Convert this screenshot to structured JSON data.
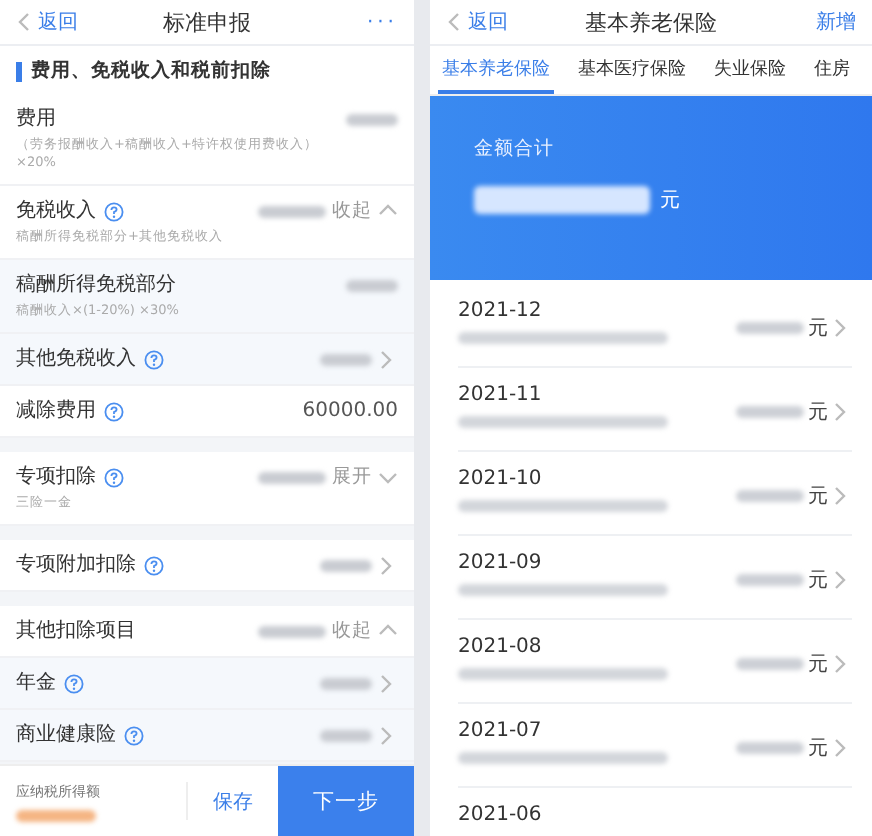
{
  "left": {
    "header": {
      "back": "返回",
      "title": "标准申报",
      "more": "···"
    },
    "section_title": "费用、免税收入和税前扣除",
    "groups": [
      {
        "rows": [
          {
            "label": "费用",
            "help": false,
            "sub": "（劳务报酬收入+稿酬收入+特许权使用费收入）×20%",
            "masked": true,
            "arrow": false
          },
          {
            "label": "免税收入",
            "help": true,
            "sub": "稿酬所得免税部分+其他免税收入",
            "masked": true,
            "toggle": "收起",
            "expanded": true,
            "children": [
              {
                "label": "稿酬所得免税部分",
                "help": false,
                "sub": "稿酬收入×(1-20%) ×30%",
                "masked": true,
                "arrow": false
              },
              {
                "label": "其他免税收入",
                "help": true,
                "masked": true,
                "arrow": true
              }
            ]
          },
          {
            "label": "减除费用",
            "help": true,
            "value": "60000.00",
            "masked": false,
            "arrow": false
          }
        ]
      },
      {
        "rows": [
          {
            "label": "专项扣除",
            "help": true,
            "sub": "三险一金",
            "masked": true,
            "toggle": "展开",
            "expanded": false
          }
        ]
      },
      {
        "rows": [
          {
            "label": "专项附加扣除",
            "help": true,
            "masked": true,
            "arrow": true
          }
        ]
      },
      {
        "rows": [
          {
            "label": "其他扣除项目",
            "help": false,
            "masked": true,
            "toggle": "收起",
            "expanded": true,
            "children": [
              {
                "label": "年金",
                "help": true,
                "masked": true,
                "arrow": true
              },
              {
                "label": "商业健康险",
                "help": true,
                "masked": true,
                "arrow": true
              }
            ]
          }
        ]
      }
    ],
    "footer": {
      "label": "应纳税所得额",
      "save": "保存",
      "next": "下一步"
    }
  },
  "right": {
    "header": {
      "back": "返回",
      "title": "基本养老保险",
      "action": "新增"
    },
    "tabs": [
      {
        "label": "基本养老保险",
        "selected": true
      },
      {
        "label": "基本医疗保险",
        "selected": false
      },
      {
        "label": "失业保险",
        "selected": false
      },
      {
        "label": "住房",
        "selected": false
      }
    ],
    "summary": {
      "label": "金额合计",
      "unit": "元"
    },
    "records": [
      {
        "date": "2021-12",
        "unit": "元"
      },
      {
        "date": "2021-11",
        "unit": "元"
      },
      {
        "date": "2021-10",
        "unit": "元"
      },
      {
        "date": "2021-09",
        "unit": "元"
      },
      {
        "date": "2021-08",
        "unit": "元"
      },
      {
        "date": "2021-07",
        "unit": "元"
      },
      {
        "date": "2021-06"
      }
    ]
  }
}
